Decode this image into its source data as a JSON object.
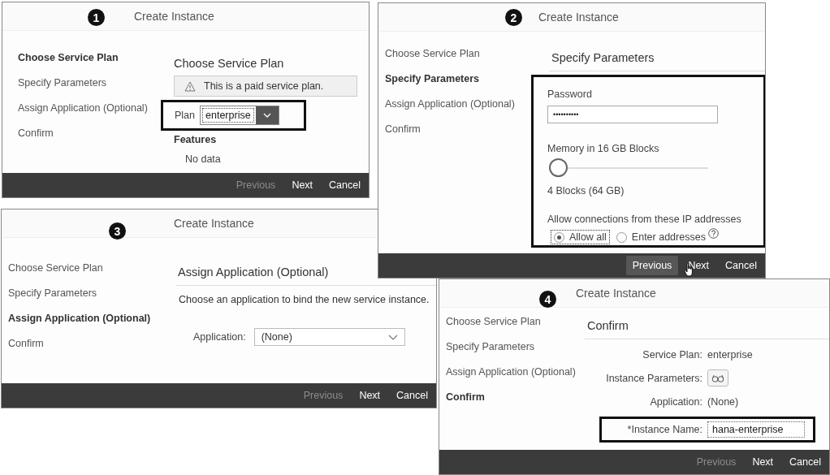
{
  "panels": [
    {
      "kind": "plan",
      "number": "1",
      "title": "Create Instance",
      "steps": [
        {
          "label": "Choose Service Plan",
          "selected": true
        },
        {
          "label": "Specify Parameters",
          "selected": false
        },
        {
          "label": "Assign Application (Optional)",
          "selected": false
        },
        {
          "label": "Confirm",
          "selected": false
        }
      ],
      "heading": "Choose Service Plan",
      "warning": "This is a paid service plan.",
      "framed": true,
      "plan_label": "Plan",
      "plan_value": "enterprise",
      "features_label": "Features",
      "features_value": "No data",
      "buttons": [
        {
          "label": "Previous",
          "disabled": true,
          "hovered": false
        },
        {
          "label": "Next",
          "disabled": false,
          "hovered": false
        },
        {
          "label": "Cancel",
          "disabled": false,
          "hovered": false
        }
      ]
    },
    {
      "kind": "params",
      "number": "2",
      "title": "Create Instance",
      "steps": [
        {
          "label": "Choose Service Plan",
          "selected": false
        },
        {
          "label": "Specify Parameters",
          "selected": true
        },
        {
          "label": "Assign Application (Optional)",
          "selected": false
        },
        {
          "label": "Confirm",
          "selected": false
        }
      ],
      "heading": "Specify Parameters",
      "framed": true,
      "password_label": "Password",
      "password_value": "••••••••••",
      "memory_label": "Memory in 16 GB Blocks",
      "memory": {
        "level": 0
      },
      "memory_reading": "4 Blocks (64 GB)",
      "ip_label": "Allow connections from these IP addresses",
      "ip_options": [
        {
          "label": "Allow all",
          "selected": true
        },
        {
          "label": "Enter addresses",
          "selected": false
        }
      ],
      "buttons": [
        {
          "label": "Previous",
          "disabled": false,
          "hovered": true
        },
        {
          "label": "Next",
          "disabled": false,
          "hovered": false
        },
        {
          "label": "Cancel",
          "disabled": false,
          "hovered": false
        }
      ]
    },
    {
      "kind": "assign",
      "number": "3",
      "title": "Create Instance",
      "steps": [
        {
          "label": "Choose Service Plan",
          "selected": false
        },
        {
          "label": "Specify Parameters",
          "selected": false
        },
        {
          "label": "Assign Application (Optional)",
          "selected": true
        },
        {
          "label": "Confirm",
          "selected": false
        }
      ],
      "heading": "Assign Application (Optional)",
      "description": "Choose an application to bind the new service instance.",
      "app_label": "Application:",
      "app_value": "(None)",
      "buttons": [
        {
          "label": "Previous",
          "disabled": true,
          "hovered": false
        },
        {
          "label": "Next",
          "disabled": false,
          "hovered": false
        },
        {
          "label": "Cancel",
          "disabled": false,
          "hovered": false
        }
      ]
    },
    {
      "kind": "confirm",
      "number": "4",
      "title": "Create Instance",
      "steps": [
        {
          "label": "Choose Service Plan",
          "selected": false
        },
        {
          "label": "Specify Parameters",
          "selected": false
        },
        {
          "label": "Assign Application (Optional)",
          "selected": false
        },
        {
          "label": "Confirm",
          "selected": true
        }
      ],
      "heading": "Confirm",
      "rows": [
        {
          "kind": "text",
          "label": "Service Plan:",
          "value": "enterprise",
          "framed": false
        },
        {
          "kind": "button",
          "label": "Instance Parameters:",
          "framed": false
        },
        {
          "kind": "text",
          "label": "Application:",
          "value": "(None)",
          "framed": false
        },
        {
          "kind": "input",
          "label": "*Instance Name:",
          "value": "hana-enterprise",
          "framed": true
        }
      ],
      "buttons": [
        {
          "label": "Previous",
          "disabled": true,
          "hovered": false
        },
        {
          "label": "Next",
          "disabled": false,
          "hovered": false
        },
        {
          "label": "Cancel",
          "disabled": false,
          "hovered": false
        }
      ]
    }
  ]
}
